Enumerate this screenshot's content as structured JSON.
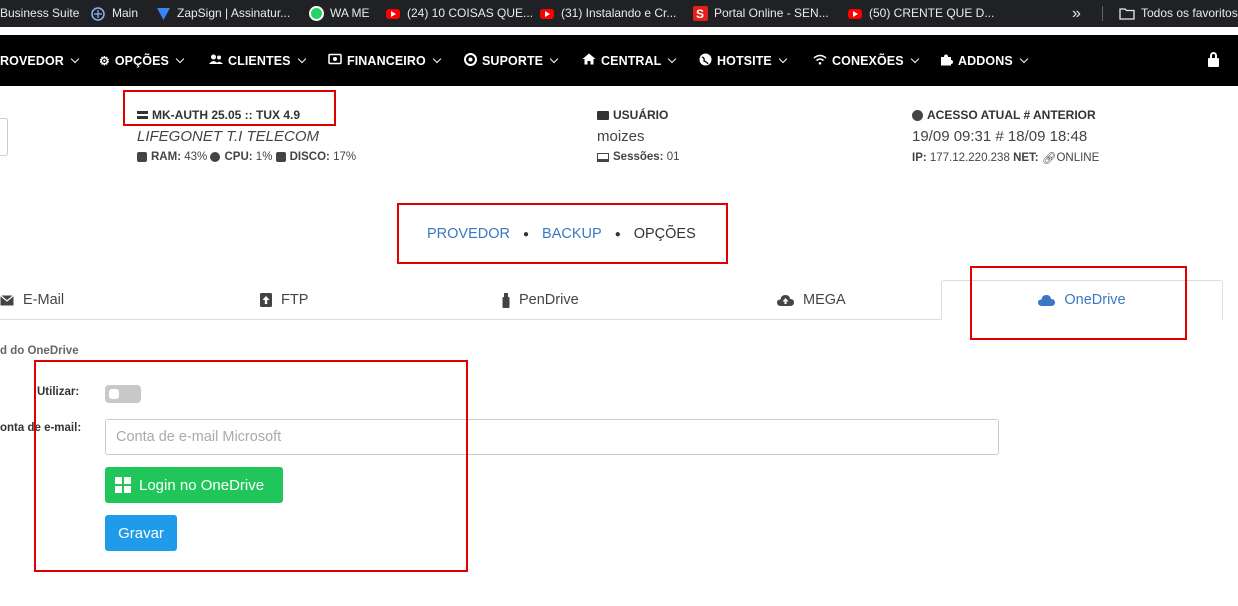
{
  "bookmarks": [
    {
      "label": "Business Suite",
      "icon": "business-suite-icon"
    },
    {
      "label": "Main",
      "icon": "main-icon"
    },
    {
      "label": "ZapSign | Assinatur...",
      "icon": "zapsign-icon"
    },
    {
      "label": "WA ME",
      "icon": "whatsapp-icon"
    },
    {
      "label": "(24) 10 COISAS QUE...",
      "icon": "youtube-icon"
    },
    {
      "label": "(31) Instalando e Cr...",
      "icon": "youtube-icon"
    },
    {
      "label": "Portal Online - SEN...",
      "icon": "portal-icon"
    },
    {
      "label": "(50) CRENTE QUE D...",
      "icon": "youtube-icon"
    }
  ],
  "bookmarks_more": "»",
  "all_favorites": "Todos os favoritos",
  "nav": [
    {
      "label": "ROVEDOR",
      "icon": ""
    },
    {
      "label": "OPÇÕES",
      "icon": "gear-icon"
    },
    {
      "label": "CLIENTES",
      "icon": "users-icon"
    },
    {
      "label": "FINANCEIRO",
      "icon": "money-icon"
    },
    {
      "label": "SUPORTE",
      "icon": "support-icon"
    },
    {
      "label": "CENTRAL",
      "icon": "home-icon"
    },
    {
      "label": "HOTSITE",
      "icon": "globe-icon"
    },
    {
      "label": "CONEXÕES",
      "icon": "wifi-icon"
    },
    {
      "label": "ADDONS",
      "icon": "puzzle-icon"
    }
  ],
  "server": {
    "version": "MK-AUTH 25.05 :: TUX 4.9",
    "company": "LIFEGONET T.I TELECOM",
    "ram_label": "RAM:",
    "ram_value": "43%",
    "cpu_label": "CPU:",
    "cpu_value": "1%",
    "disk_label": "DISCO:",
    "disk_value": "17%"
  },
  "user": {
    "label": "USUÁRIO",
    "name": "moizes",
    "sessions_label": "Sessões:",
    "sessions_value": "01"
  },
  "access": {
    "label": "ACESSO ATUAL # ANTERIOR",
    "value": "19/09 09:31 # 18/09 18:48",
    "ip_label": "IP:",
    "ip_value": "177.12.220.238",
    "net_label": "NET:",
    "net_value": "ONLINE"
  },
  "breadcrumb": {
    "item1": "PROVEDOR",
    "item2": "BACKUP",
    "current": "OPÇÕES"
  },
  "tabs": [
    {
      "label": "E-Mail",
      "icon": "envelope-icon"
    },
    {
      "label": "FTP",
      "icon": "upload-icon"
    },
    {
      "label": "PenDrive",
      "icon": "usb-icon"
    },
    {
      "label": "MEGA",
      "icon": "cloud-upload-icon"
    },
    {
      "label": "OneDrive",
      "icon": "cloud-icon",
      "active": true
    }
  ],
  "form": {
    "section_title": "d do OneDrive",
    "use_label": "Utilizar:",
    "use_enabled": false,
    "email_label": "onta de e-mail:",
    "email_placeholder": "Conta de e-mail Microsoft",
    "email_value": "",
    "login_button": "Login no OneDrive",
    "save_button": "Gravar"
  },
  "colors": {
    "nav_bg": "#000000",
    "link": "#3a78c3",
    "login_button": "#21c65b",
    "save_button": "#1e9be9",
    "highlight_box": "#e00000"
  }
}
